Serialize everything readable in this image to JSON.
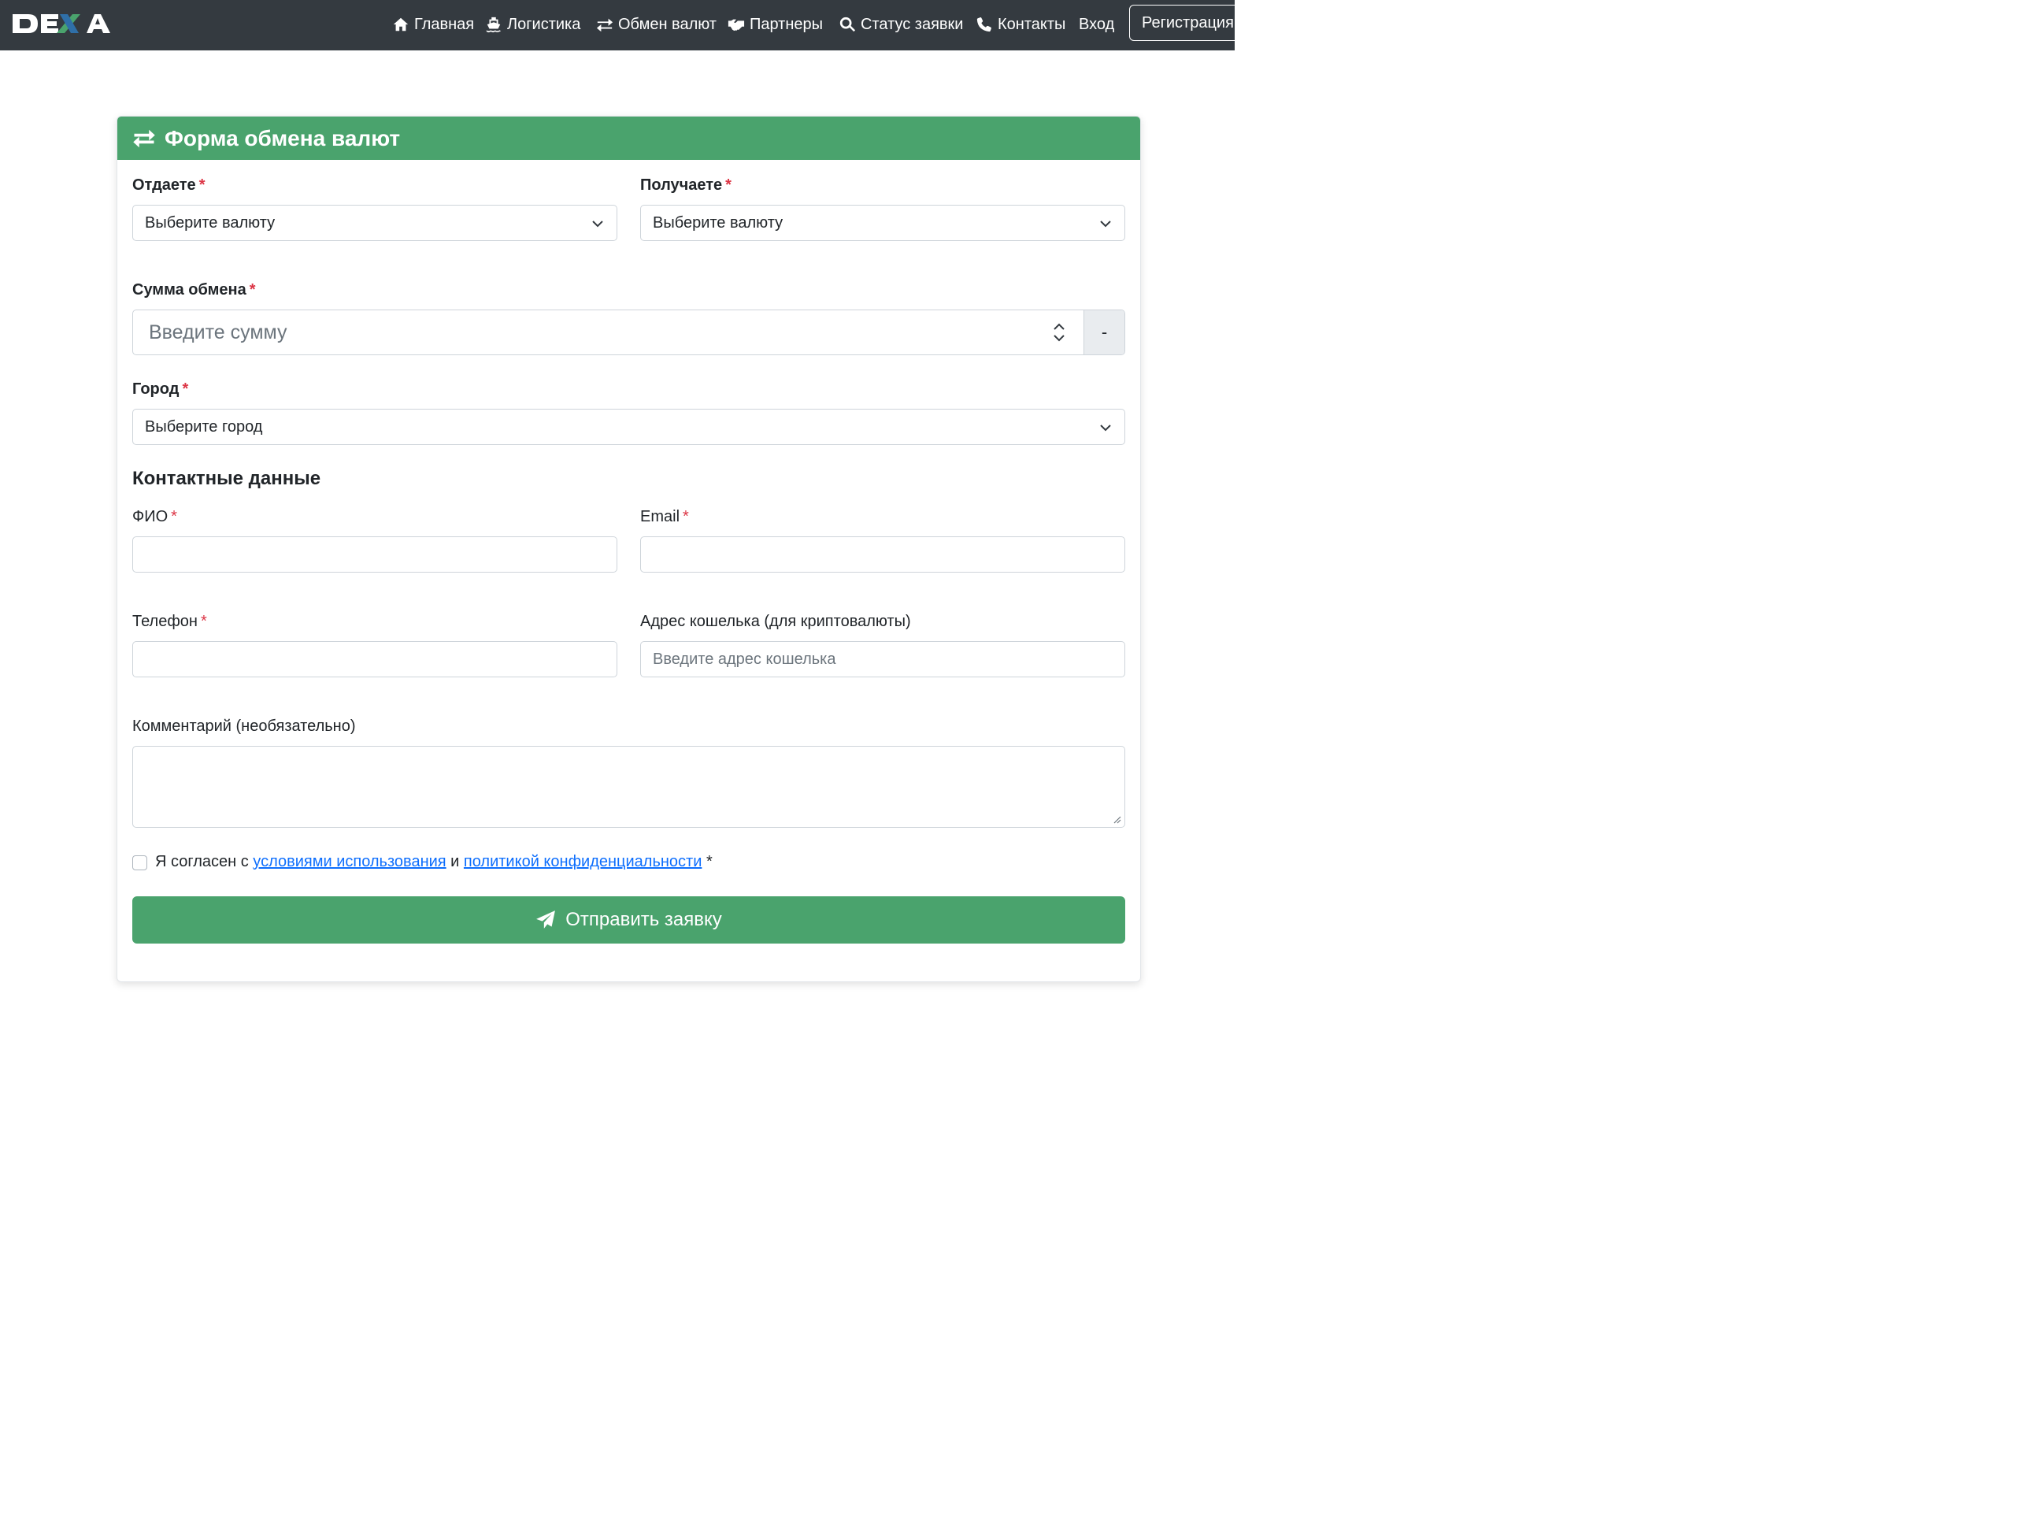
{
  "navbar": {
    "logo_text": "DEXA",
    "items": [
      {
        "label": "Главная",
        "icon": "home-icon"
      },
      {
        "label": "Логистика",
        "icon": "ship-icon"
      },
      {
        "label": "Обмен валют",
        "icon": "exchange-icon"
      },
      {
        "label": "Партнеры",
        "icon": "handshake-icon"
      },
      {
        "label": "Статус заявки",
        "icon": "search-icon"
      },
      {
        "label": "Контакты",
        "icon": "phone-icon"
      },
      {
        "label": "Вход",
        "icon": ""
      }
    ],
    "register_label": "Регистрация"
  },
  "form": {
    "title": "Форма обмена валют",
    "give": {
      "label": "Отдаете",
      "required": "*",
      "value": "Выберите валюту"
    },
    "receive": {
      "label": "Получаете",
      "required": "*",
      "value": "Выберите валюту"
    },
    "amount": {
      "label": "Сумма обмена",
      "required": "*",
      "placeholder": "Введите сумму",
      "addon": "-"
    },
    "city": {
      "label": "Город",
      "required": "*",
      "value": "Выберите город"
    },
    "contacts_title": "Контактные данные",
    "fio": {
      "label": "ФИО",
      "required": "*",
      "value": ""
    },
    "email": {
      "label": "Email",
      "required": "*",
      "value": ""
    },
    "phone": {
      "label": "Телефон",
      "required": "*",
      "value": ""
    },
    "wallet": {
      "label": "Адрес кошелька (для криптовалюты)",
      "placeholder": "Введите адрес кошелька"
    },
    "comment": {
      "label": "Комментарий (необязательно)",
      "value": ""
    },
    "agree": {
      "prefix": "Я согласен с",
      "terms_link": "условиями использования",
      "middle": "и",
      "privacy_link": "политикой конфиденциальности",
      "suffix": "*"
    },
    "submit_label": "Отправить заявку"
  },
  "colors": {
    "navbar_bg": "#343a40",
    "accent_green": "#4aa36d",
    "required_red": "#dc3545",
    "link_blue": "#0d6efd"
  }
}
